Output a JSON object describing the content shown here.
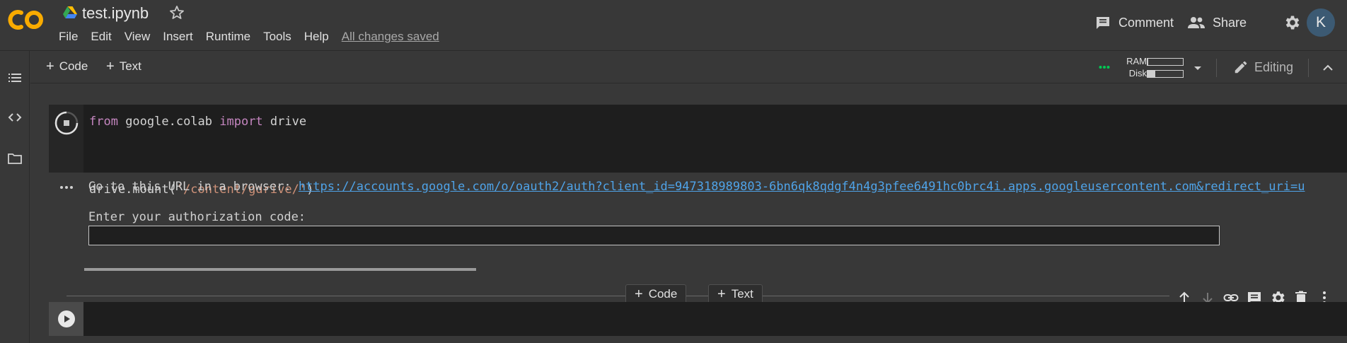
{
  "app": {
    "logo_text": "CO",
    "notebook_title": "test.ipynb",
    "save_status": "All changes saved",
    "accent_color": "#f9ab00"
  },
  "menu": [
    "File",
    "Edit",
    "View",
    "Insert",
    "Runtime",
    "Tools",
    "Help"
  ],
  "header_actions": {
    "comment_label": "Comment",
    "share_label": "Share",
    "avatar_initial": "K"
  },
  "toolbar": {
    "add_code_label": "Code",
    "add_text_label": "Text",
    "ram_label": "RAM",
    "disk_label": "Disk",
    "ram_usage_fraction": 0.02,
    "disk_usage_fraction": 0.22,
    "editing_label": "Editing",
    "status_color": "#00c853"
  },
  "sidebar": {
    "icons": [
      "table-of-contents-icon",
      "code-snippets-icon",
      "files-icon"
    ]
  },
  "cell1": {
    "code_lines": [
      {
        "kw1": "from",
        "mid": " google.colab ",
        "kw2": "import",
        "tail": " drive"
      },
      {
        "pre": "drive.mount(",
        "str": "'/content/gdrive/'",
        "post": ")"
      }
    ],
    "status": "running"
  },
  "output": {
    "url_prompt": "Go to this URL in a browser: ",
    "url": "https://accounts.google.com/o/oauth2/auth?client_id=947318989803-6bn6qk8qdgf4n4g3pfee6491hc0brc4i.apps.googleusercontent.com&redirect_uri=u",
    "auth_prompt": "Enter your authorization code:",
    "auth_value": ""
  },
  "insert_bar": {
    "code_label": "Code",
    "text_label": "Text"
  },
  "cell_toolbar": {
    "icons": [
      "move-up-icon",
      "move-down-icon",
      "link-icon",
      "comment-icon",
      "settings-icon",
      "delete-icon",
      "more-vert-icon"
    ]
  }
}
